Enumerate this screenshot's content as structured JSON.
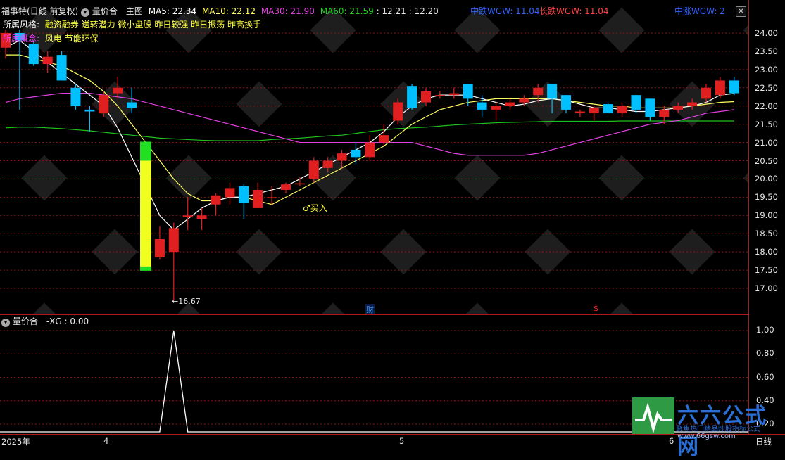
{
  "header": {
    "stock_title": "福事特(日线 前复权)",
    "formula_name": "量价合一主图",
    "ma5_label": "MA5: 22.34",
    "ma10_label": "MA10: 22.12",
    "ma30_label": "MA30: 21.90",
    "ma60_label": "MA60: 21.59",
    "extra1": ": 12.21",
    "extra2": ": 12.20",
    "mid_wgw": "中跌WGW: 11.04",
    "long_wgw": "长跌WGW: 11.04",
    "mid_wgw2": "中涨WGW: 2"
  },
  "tags": {
    "style_label": "所属风格:",
    "style_values": "融资融券 送转潜力 微小盘股 昨日较强 昨日振荡 昨高换手",
    "concept_label": "所属概念:",
    "concept_values": "风电 节能环保"
  },
  "annotations": {
    "low_price": "16.67",
    "buy_signal": "买入",
    "cai_marker": "财",
    "s_marker": "$"
  },
  "sub_header": {
    "title": "量价合一-XG",
    "value": ": 0.00"
  },
  "price_axis": [
    "24.00",
    "23.50",
    "23.00",
    "22.50",
    "22.00",
    "21.50",
    "21.00",
    "20.50",
    "20.00",
    "19.50",
    "19.00",
    "18.50",
    "18.00",
    "17.50",
    "17.00"
  ],
  "sub_axis": [
    "1.00",
    "0.80",
    "0.60",
    "0.40",
    "0.20"
  ],
  "bottom_axis": {
    "year": "2025年",
    "m4": "4",
    "m5": "5",
    "m6": "6",
    "period": "日线"
  },
  "brand": {
    "name": "六六公式网",
    "slogan": "聚焦热门精品炒股指标公式",
    "url": "www.66gsw.com"
  },
  "chart_data": {
    "type": "candlestick",
    "y_range": [
      16.6,
      24.3
    ],
    "candles": [
      {
        "o": 23.6,
        "h": 24.1,
        "l": 23.3,
        "c": 24.0
      },
      {
        "o": 24.0,
        "h": 24.1,
        "l": 21.9,
        "c": 23.8
      },
      {
        "o": 23.7,
        "h": 23.8,
        "l": 23.1,
        "c": 23.15
      },
      {
        "o": 23.15,
        "h": 23.5,
        "l": 22.9,
        "c": 23.35
      },
      {
        "o": 23.4,
        "h": 23.5,
        "l": 22.7,
        "c": 22.7
      },
      {
        "o": 22.5,
        "h": 22.6,
        "l": 21.9,
        "c": 22.0
      },
      {
        "o": 21.9,
        "h": 22.0,
        "l": 21.3,
        "c": 21.85
      },
      {
        "o": 21.8,
        "h": 22.4,
        "l": 21.7,
        "c": 22.3
      },
      {
        "o": 22.35,
        "h": 22.8,
        "l": 22.2,
        "c": 22.5
      },
      {
        "o": 22.1,
        "h": 22.5,
        "l": 21.8,
        "c": 21.95
      },
      {
        "o": 20.5,
        "h": 20.5,
        "l": 17.6,
        "c": 17.6
      },
      {
        "o": 17.85,
        "h": 18.7,
        "l": 17.8,
        "c": 18.35
      },
      {
        "o": 18.0,
        "h": 18.8,
        "l": 16.67,
        "c": 18.65
      },
      {
        "o": 18.95,
        "h": 19.5,
        "l": 18.6,
        "c": 19.0
      },
      {
        "o": 18.9,
        "h": 19.2,
        "l": 18.6,
        "c": 19.0
      },
      {
        "o": 19.3,
        "h": 19.6,
        "l": 19.0,
        "c": 19.55
      },
      {
        "o": 19.5,
        "h": 19.9,
        "l": 19.3,
        "c": 19.75
      },
      {
        "o": 19.8,
        "h": 19.85,
        "l": 18.9,
        "c": 19.35
      },
      {
        "o": 19.2,
        "h": 19.9,
        "l": 19.2,
        "c": 19.7
      },
      {
        "o": 19.5,
        "h": 19.8,
        "l": 19.3,
        "c": 19.5
      },
      {
        "o": 19.7,
        "h": 19.9,
        "l": 19.6,
        "c": 19.85
      },
      {
        "o": 19.85,
        "h": 20.05,
        "l": 19.8,
        "c": 19.88
      },
      {
        "o": 20.0,
        "h": 20.6,
        "l": 19.9,
        "c": 20.5
      },
      {
        "o": 20.3,
        "h": 20.6,
        "l": 20.2,
        "c": 20.5
      },
      {
        "o": 20.5,
        "h": 20.8,
        "l": 20.3,
        "c": 20.7
      },
      {
        "o": 20.8,
        "h": 21.0,
        "l": 20.4,
        "c": 20.6
      },
      {
        "o": 20.6,
        "h": 21.2,
        "l": 20.5,
        "c": 21.0
      },
      {
        "o": 21.0,
        "h": 21.5,
        "l": 20.9,
        "c": 21.2
      },
      {
        "o": 21.6,
        "h": 22.2,
        "l": 21.5,
        "c": 22.1
      },
      {
        "o": 22.55,
        "h": 22.6,
        "l": 21.9,
        "c": 21.95
      },
      {
        "o": 22.1,
        "h": 22.5,
        "l": 22.0,
        "c": 22.4
      },
      {
        "o": 22.3,
        "h": 22.4,
        "l": 22.2,
        "c": 22.3
      },
      {
        "o": 22.3,
        "h": 22.5,
        "l": 22.2,
        "c": 22.35
      },
      {
        "o": 22.6,
        "h": 22.6,
        "l": 22.0,
        "c": 22.2
      },
      {
        "o": 22.1,
        "h": 22.3,
        "l": 21.7,
        "c": 21.9
      },
      {
        "o": 21.9,
        "h": 22.1,
        "l": 21.6,
        "c": 22.0
      },
      {
        "o": 22.0,
        "h": 22.2,
        "l": 21.9,
        "c": 22.1
      },
      {
        "o": 22.1,
        "h": 22.3,
        "l": 22.0,
        "c": 22.2
      },
      {
        "o": 22.3,
        "h": 22.6,
        "l": 22.1,
        "c": 22.5
      },
      {
        "o": 22.6,
        "h": 22.6,
        "l": 21.8,
        "c": 22.2
      },
      {
        "o": 22.3,
        "h": 22.3,
        "l": 21.8,
        "c": 21.9
      },
      {
        "o": 21.8,
        "h": 21.9,
        "l": 21.7,
        "c": 21.85
      },
      {
        "o": 21.8,
        "h": 22.0,
        "l": 21.6,
        "c": 21.95
      },
      {
        "o": 22.05,
        "h": 22.1,
        "l": 21.8,
        "c": 21.8
      },
      {
        "o": 21.8,
        "h": 22.1,
        "l": 21.7,
        "c": 22.0
      },
      {
        "o": 22.3,
        "h": 22.3,
        "l": 21.8,
        "c": 21.9
      },
      {
        "o": 22.2,
        "h": 22.2,
        "l": 21.6,
        "c": 21.7
      },
      {
        "o": 21.7,
        "h": 22.0,
        "l": 21.5,
        "c": 21.9
      },
      {
        "o": 21.9,
        "h": 22.1,
        "l": 21.8,
        "c": 22.0
      },
      {
        "o": 22.0,
        "h": 22.2,
        "l": 21.9,
        "c": 22.1
      },
      {
        "o": 22.2,
        "h": 22.6,
        "l": 22.1,
        "c": 22.5
      },
      {
        "o": 22.3,
        "h": 22.8,
        "l": 22.2,
        "c": 22.7
      },
      {
        "o": 22.7,
        "h": 22.8,
        "l": 22.3,
        "c": 22.35
      }
    ],
    "ma5": [
      23.6,
      23.8,
      23.5,
      23.2,
      22.9,
      22.6,
      22.3,
      22.0,
      21.4,
      20.6,
      19.8,
      19.0,
      18.6,
      18.9,
      19.2,
      19.4,
      19.5,
      19.5,
      19.6,
      19.7,
      19.8,
      20.0,
      20.2,
      20.4,
      20.6,
      20.8,
      21.0,
      21.3,
      21.7,
      22.0,
      22.2,
      22.3,
      22.3,
      22.3,
      22.2,
      22.1,
      22.0,
      22.05,
      22.15,
      22.2,
      22.15,
      22.05,
      21.95,
      21.95,
      21.9,
      21.85,
      21.85,
      21.9,
      21.95,
      22.0,
      22.1,
      22.3,
      22.34
    ],
    "ma10": [
      23.4,
      23.4,
      23.3,
      23.2,
      23.1,
      22.9,
      22.7,
      22.4,
      22.0,
      21.5,
      21.0,
      20.5,
      20.0,
      19.6,
      19.4,
      19.4,
      19.5,
      19.5,
      19.4,
      19.3,
      19.5,
      19.7,
      19.9,
      20.1,
      20.3,
      20.5,
      20.7,
      20.9,
      21.2,
      21.5,
      21.7,
      21.9,
      22.0,
      22.1,
      22.15,
      22.2,
      22.2,
      22.2,
      22.2,
      22.2,
      22.15,
      22.1,
      22.05,
      22.0,
      22.0,
      21.95,
      21.95,
      21.95,
      21.95,
      22.0,
      22.05,
      22.1,
      22.12
    ],
    "ma30": [
      22.1,
      22.2,
      22.25,
      22.3,
      22.35,
      22.35,
      22.35,
      22.3,
      22.25,
      22.2,
      22.1,
      22.0,
      21.9,
      21.8,
      21.7,
      21.6,
      21.5,
      21.4,
      21.3,
      21.2,
      21.1,
      21.0,
      21.0,
      21.0,
      21.0,
      21.0,
      21.0,
      21.0,
      21.0,
      21.0,
      20.9,
      20.8,
      20.7,
      20.65,
      20.65,
      20.65,
      20.65,
      20.65,
      20.7,
      20.8,
      20.9,
      21.0,
      21.1,
      21.2,
      21.3,
      21.4,
      21.5,
      21.55,
      21.6,
      21.7,
      21.8,
      21.85,
      21.9
    ],
    "ma60": [
      21.4,
      21.42,
      21.42,
      21.4,
      21.38,
      21.35,
      21.32,
      21.28,
      21.24,
      21.2,
      21.16,
      21.12,
      21.1,
      21.08,
      21.06,
      21.05,
      21.05,
      21.05,
      21.05,
      21.08,
      21.1,
      21.12,
      21.15,
      21.18,
      21.2,
      21.25,
      21.3,
      21.35,
      21.38,
      21.4,
      21.42,
      21.45,
      21.48,
      21.5,
      21.52,
      21.54,
      21.55,
      21.56,
      21.57,
      21.58,
      21.58,
      21.58,
      21.58,
      21.58,
      21.59,
      21.59,
      21.59,
      21.59,
      21.59,
      21.59,
      21.59,
      21.59,
      21.59
    ],
    "signal_bar": {
      "index": 10,
      "top": 20.5,
      "bottom": 17.6
    },
    "xg": [
      0,
      0,
      0,
      0,
      0,
      0,
      0,
      0,
      0,
      0,
      0,
      0,
      1,
      0,
      0,
      0,
      0,
      0,
      0,
      0,
      0,
      0,
      0,
      0,
      0,
      0,
      0,
      0,
      0,
      0,
      0,
      0,
      0,
      0,
      0,
      0,
      0,
      0,
      0,
      0,
      0,
      0,
      0,
      0,
      0,
      0,
      0,
      0,
      0,
      0,
      0,
      0,
      0
    ],
    "colors": {
      "up": "#e02020",
      "down": "#00c0ff",
      "ma5": "#ffffff",
      "ma10": "#ffff60",
      "ma30": "#e040e0",
      "ma60": "#20c020",
      "grid": "#8a1818"
    }
  }
}
